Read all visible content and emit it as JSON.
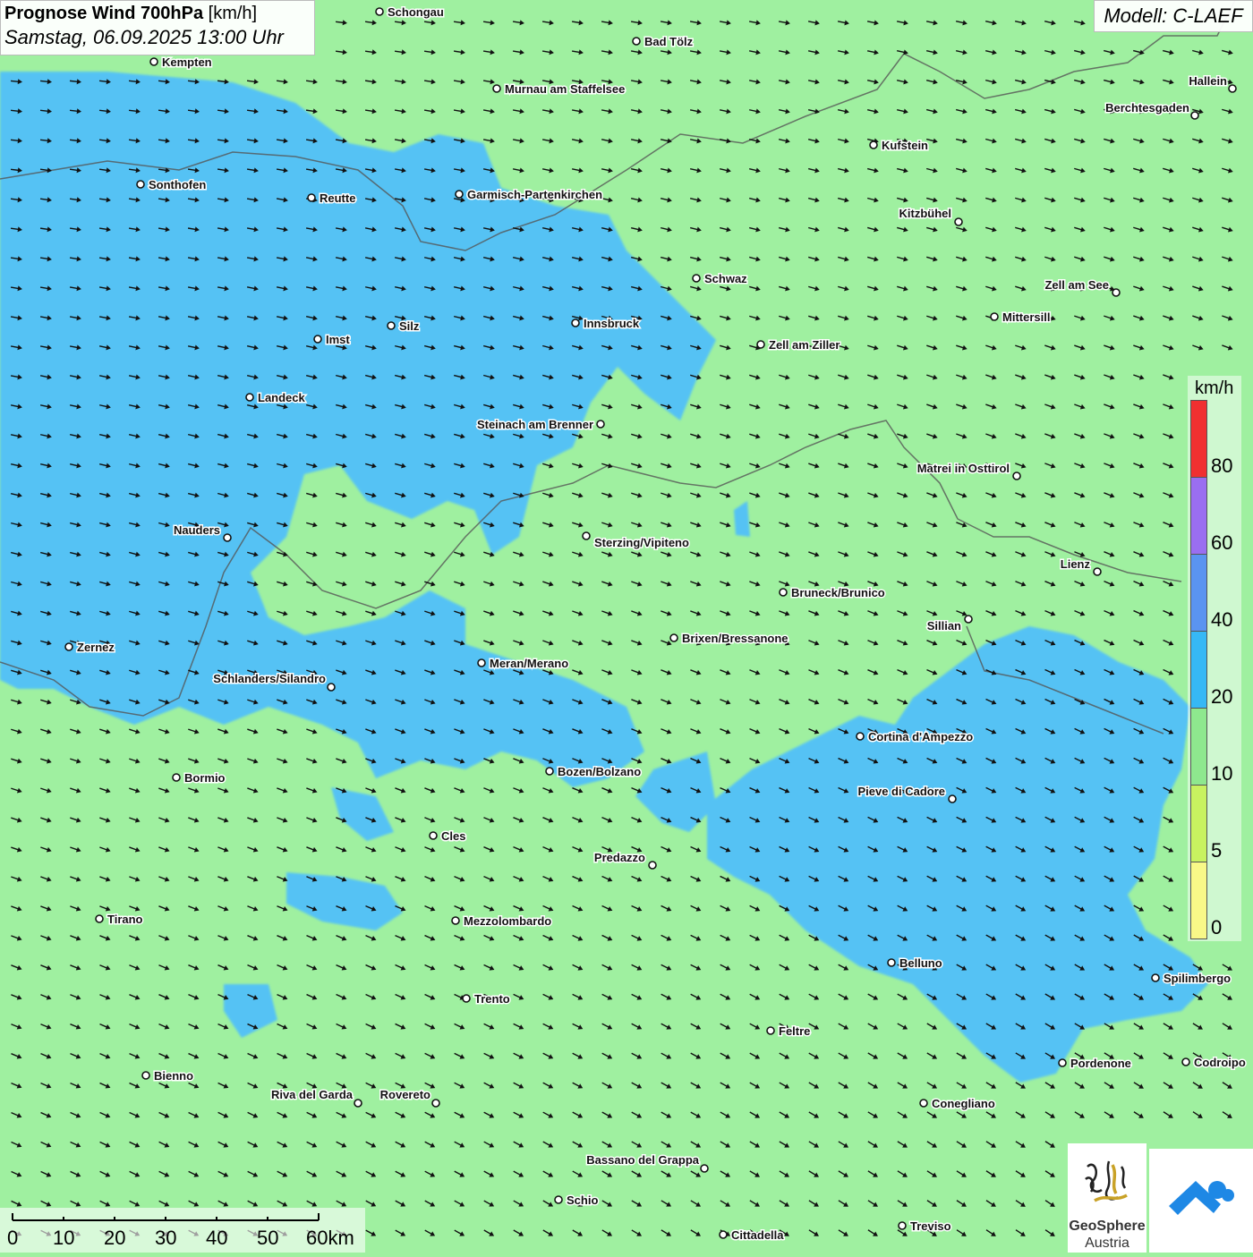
{
  "header": {
    "title_bold": "Prognose Wind 700hPa",
    "title_unit": "[km/h]",
    "datetime": "Samstag, 06.09.2025 13:00 Uhr",
    "model": "Modell: C-LAEF"
  },
  "legend": {
    "unit": "km/h",
    "ticks": [
      "80",
      "60",
      "40",
      "20",
      "10",
      "5",
      "0"
    ],
    "colors": [
      "#f03030",
      "#9a6ef0",
      "#5a94f0",
      "#36b8f5",
      "#8ee88e",
      "#c8f260",
      "#f8f888"
    ]
  },
  "scale": {
    "labels": [
      "0",
      "10",
      "20",
      "30",
      "40",
      "50",
      "60km"
    ]
  },
  "colors": {
    "field_low": "#9ff0a0",
    "field_high": "#54c2f4",
    "arrow": "#111111"
  },
  "wind": {
    "direction": "west-northwest, blowing toward east-southeast"
  },
  "cities": [
    {
      "name": "Schongau"
    },
    {
      "name": "Bad Tölz"
    },
    {
      "name": "Kempten"
    },
    {
      "name": "Murnau am Staffelsee"
    },
    {
      "name": "Hallein"
    },
    {
      "name": "Berchtesgaden"
    },
    {
      "name": "Kufstein"
    },
    {
      "name": "Sonthofen"
    },
    {
      "name": "Reutte"
    },
    {
      "name": "Garmisch-Partenkirchen"
    },
    {
      "name": "Kitzbühel"
    },
    {
      "name": "Schwaz"
    },
    {
      "name": "Zell am See"
    },
    {
      "name": "Mittersill"
    },
    {
      "name": "Innsbruck"
    },
    {
      "name": "Imst"
    },
    {
      "name": "Silz"
    },
    {
      "name": "Zell am Ziller"
    },
    {
      "name": "Landeck"
    },
    {
      "name": "Steinach am Brenner"
    },
    {
      "name": "Matrei in Osttirol"
    },
    {
      "name": "Nauders"
    },
    {
      "name": "Sterzing/Vipiteno"
    },
    {
      "name": "Lienz"
    },
    {
      "name": "Bruneck/Brunico"
    },
    {
      "name": "Sillian"
    },
    {
      "name": "Brixen/Bressanone"
    },
    {
      "name": "Zernez"
    },
    {
      "name": "Meran/Merano"
    },
    {
      "name": "Schlanders/Silandro"
    },
    {
      "name": "Cortina d'Ampezzo"
    },
    {
      "name": "Bormio"
    },
    {
      "name": "Bozen/Bolzano"
    },
    {
      "name": "Pieve di Cadore"
    },
    {
      "name": "Cles"
    },
    {
      "name": "Predazzo"
    },
    {
      "name": "Tirano"
    },
    {
      "name": "Mezzolombardo"
    },
    {
      "name": "Belluno"
    },
    {
      "name": "Spilimbergo"
    },
    {
      "name": "Trento"
    },
    {
      "name": "Feltre"
    },
    {
      "name": "Bienno"
    },
    {
      "name": "Pordenone"
    },
    {
      "name": "Codroipo"
    },
    {
      "name": "Riva del Garda"
    },
    {
      "name": "Rovereto"
    },
    {
      "name": "Conegliano"
    },
    {
      "name": "Bassano del Grappa"
    },
    {
      "name": "Schio"
    },
    {
      "name": "Treviso"
    },
    {
      "name": "Cittadella"
    }
  ],
  "logo": {
    "name": "GeoSphere",
    "sub": "Austria"
  }
}
